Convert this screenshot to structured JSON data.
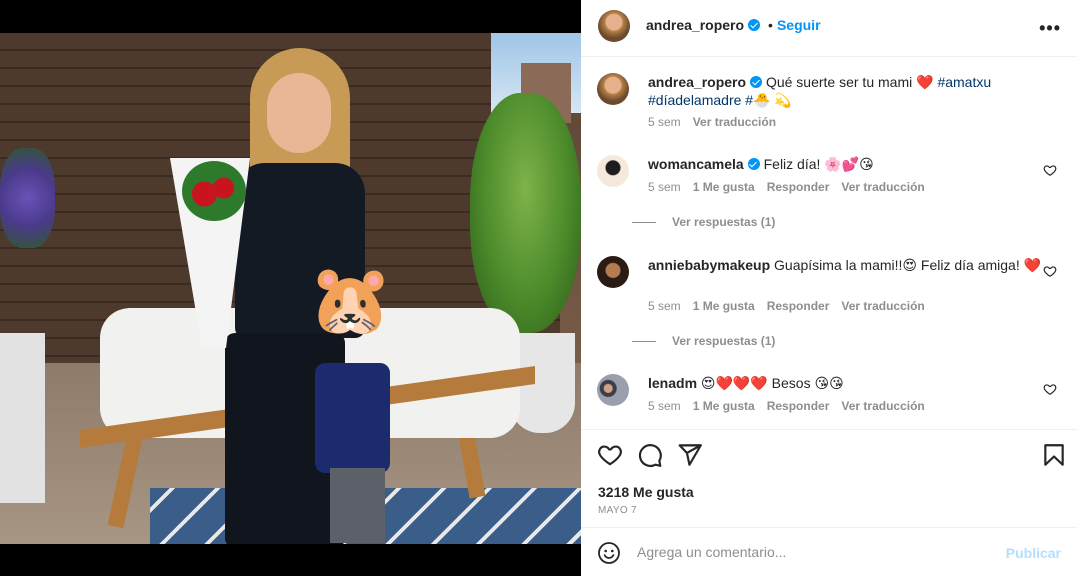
{
  "post": {
    "username": "andrea_ropero",
    "follow_label": "Seguir",
    "dot": "•",
    "more_label": "•••"
  },
  "caption": {
    "username": "andrea_ropero",
    "text": "Qué suerte ser tu mami ❤️",
    "hashtag1": "#amatxu",
    "hashtag2": "#díadelamadre",
    "hashtag3": "#🐣",
    "emoji_tail": "💫",
    "time": "5 sem",
    "translate": "Ver traducción"
  },
  "comments": [
    {
      "username": "womancamela",
      "verified": true,
      "text": "Feliz día! 🌸💕😘",
      "time": "5 sem",
      "likes": "1 Me gusta",
      "reply": "Responder",
      "translate": "Ver traducción",
      "replies": "Ver respuestas (1)"
    },
    {
      "username": "anniebabymakeup",
      "verified": false,
      "text": "Guapísima la mami!!😍 Feliz día amiga! ❤️",
      "time": "5 sem",
      "likes": "1 Me gusta",
      "reply": "Responder",
      "translate": "Ver traducción",
      "replies": "Ver respuestas (1)"
    },
    {
      "username": "lenadm",
      "verified": false,
      "text": "😍❤️❤️❤️ Besos 😘😘",
      "time": "5 sem",
      "likes": "1 Me gusta",
      "reply": "Responder",
      "translate": "Ver traducción"
    }
  ],
  "stats": {
    "likes": "3218 Me gusta",
    "date": "MAYO 7"
  },
  "composer": {
    "placeholder": "Agrega un comentario...",
    "publish_label": "Publicar"
  },
  "photo": {
    "face_emoji": "🐹"
  },
  "colors": {
    "accent": "#0095f6",
    "hashtag": "#00376b",
    "muted": "#8e8e8e",
    "publish_disabled": "#b2dffc"
  }
}
